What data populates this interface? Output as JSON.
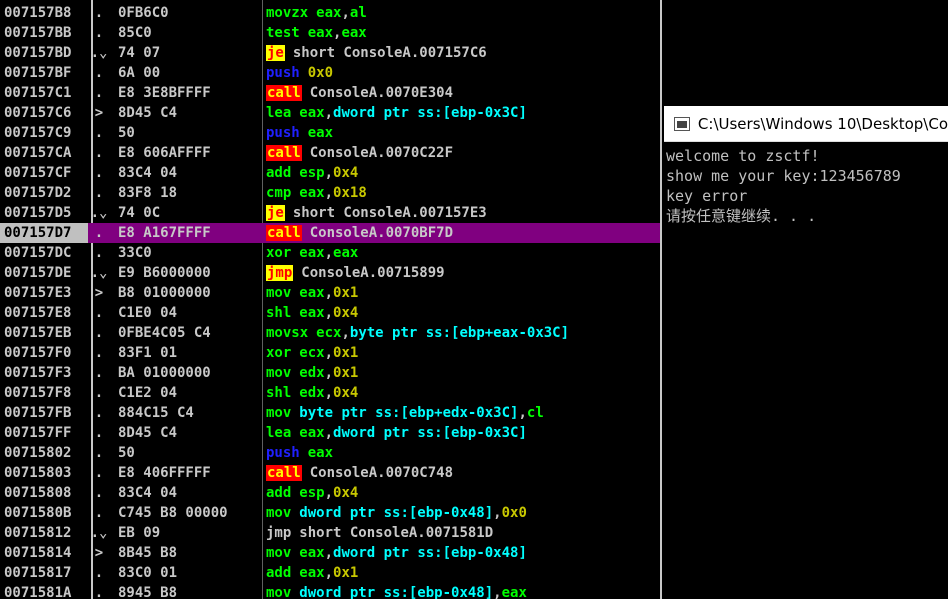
{
  "console": {
    "title": "C:\\Users\\Windows 10\\Desktop\\Co",
    "lines": [
      "welcome to zsctf!",
      "show me your key:123456789",
      "key error",
      "请按任意键继续. . ."
    ]
  },
  "disasm": {
    "rows": [
      {
        "addr": "007157B8",
        "marker": ".",
        "bytes": "0FB6C0",
        "mn": "movzx",
        "mn_style": "green",
        "ops": [
          [
            "eax",
            "reg"
          ],
          [
            ",",
            "default"
          ],
          [
            "al",
            "reg"
          ]
        ]
      },
      {
        "addr": "007157BB",
        "marker": ".",
        "bytes": "85C0",
        "mn": "test",
        "mn_style": "green",
        "ops": [
          [
            "eax",
            "reg"
          ],
          [
            ",",
            "default"
          ],
          [
            "eax",
            "reg"
          ]
        ]
      },
      {
        "addr": "007157BD",
        "marker": ".⌄",
        "bytes": "74 07",
        "mn": "je",
        "mn_style": "je",
        "ops": [
          [
            "short ConsoleA.007157C6",
            "default"
          ]
        ]
      },
      {
        "addr": "007157BF",
        "marker": ".",
        "bytes": "6A 00",
        "mn": "push",
        "mn_style": "blue",
        "ops": [
          [
            "0x0",
            "num"
          ]
        ]
      },
      {
        "addr": "007157C1",
        "marker": ".",
        "bytes": "E8 3E8BFFFF",
        "mn": "call",
        "mn_style": "call",
        "ops": [
          [
            "ConsoleA.0070E304",
            "default"
          ]
        ]
      },
      {
        "addr": "007157C6",
        "marker": ">",
        "bytes": "8D45 C4",
        "mn": "lea",
        "mn_style": "green",
        "ops": [
          [
            "eax",
            "reg"
          ],
          [
            ",",
            "default"
          ],
          [
            "dword ptr ss:[ebp-0x3C]",
            "cyan"
          ]
        ]
      },
      {
        "addr": "007157C9",
        "marker": ".",
        "bytes": "50",
        "mn": "push",
        "mn_style": "blue",
        "ops": [
          [
            "eax",
            "reg"
          ]
        ]
      },
      {
        "addr": "007157CA",
        "marker": ".",
        "bytes": "E8 606AFFFF",
        "mn": "call",
        "mn_style": "call",
        "ops": [
          [
            "ConsoleA.0070C22F",
            "default"
          ]
        ]
      },
      {
        "addr": "007157CF",
        "marker": ".",
        "bytes": "83C4 04",
        "mn": "add",
        "mn_style": "green",
        "ops": [
          [
            "esp",
            "reg"
          ],
          [
            ",",
            "default"
          ],
          [
            "0x4",
            "num"
          ]
        ]
      },
      {
        "addr": "007157D2",
        "marker": ".",
        "bytes": "83F8 18",
        "mn": "cmp",
        "mn_style": "green",
        "ops": [
          [
            "eax",
            "reg"
          ],
          [
            ",",
            "default"
          ],
          [
            "0x18",
            "num"
          ]
        ]
      },
      {
        "addr": "007157D5",
        "marker": ".⌄",
        "bytes": "74 0C",
        "mn": "je",
        "mn_style": "je",
        "ops": [
          [
            "short ConsoleA.007157E3",
            "default"
          ]
        ]
      },
      {
        "addr": "007157D7",
        "marker": ".",
        "bytes": "E8 A167FFFF",
        "mn": "call",
        "mn_style": "call",
        "ops": [
          [
            "ConsoleA.0070BF7D",
            "default"
          ]
        ],
        "selected": true
      },
      {
        "addr": "007157DC",
        "marker": ".",
        "bytes": "33C0",
        "mn": "xor",
        "mn_style": "green",
        "ops": [
          [
            "eax",
            "reg"
          ],
          [
            ",",
            "default"
          ],
          [
            "eax",
            "reg"
          ]
        ]
      },
      {
        "addr": "007157DE",
        "marker": ".⌄",
        "bytes": "E9 B6000000",
        "mn": "jmp",
        "mn_style": "je",
        "ops": [
          [
            "ConsoleA.00715899",
            "default"
          ]
        ]
      },
      {
        "addr": "007157E3",
        "marker": ">",
        "bytes": "B8 01000000",
        "mn": "mov",
        "mn_style": "green",
        "ops": [
          [
            "eax",
            "reg"
          ],
          [
            ",",
            "default"
          ],
          [
            "0x1",
            "num"
          ]
        ]
      },
      {
        "addr": "007157E8",
        "marker": ".",
        "bytes": "C1E0 04",
        "mn": "shl",
        "mn_style": "green",
        "ops": [
          [
            "eax",
            "reg"
          ],
          [
            ",",
            "default"
          ],
          [
            "0x4",
            "num"
          ]
        ]
      },
      {
        "addr": "007157EB",
        "marker": ".",
        "bytes": "0FBE4C05 C4",
        "mn": "movsx",
        "mn_style": "green",
        "ops": [
          [
            "ecx",
            "reg"
          ],
          [
            ",",
            "default"
          ],
          [
            "byte ptr ss:[ebp+eax-0x3C]",
            "cyan"
          ]
        ]
      },
      {
        "addr": "007157F0",
        "marker": ".",
        "bytes": "83F1 01",
        "mn": "xor",
        "mn_style": "green",
        "ops": [
          [
            "ecx",
            "reg"
          ],
          [
            ",",
            "default"
          ],
          [
            "0x1",
            "num"
          ]
        ]
      },
      {
        "addr": "007157F3",
        "marker": ".",
        "bytes": "BA 01000000",
        "mn": "mov",
        "mn_style": "green",
        "ops": [
          [
            "edx",
            "reg"
          ],
          [
            ",",
            "default"
          ],
          [
            "0x1",
            "num"
          ]
        ]
      },
      {
        "addr": "007157F8",
        "marker": ".",
        "bytes": "C1E2 04",
        "mn": "shl",
        "mn_style": "green",
        "ops": [
          [
            "edx",
            "reg"
          ],
          [
            ",",
            "default"
          ],
          [
            "0x4",
            "num"
          ]
        ]
      },
      {
        "addr": "007157FB",
        "marker": ".",
        "bytes": "884C15 C4",
        "mn": "mov",
        "mn_style": "green",
        "ops": [
          [
            "byte ptr ss:[ebp+edx-0x3C]",
            "cyan"
          ],
          [
            ",",
            "default"
          ],
          [
            "cl",
            "reg"
          ]
        ]
      },
      {
        "addr": "007157FF",
        "marker": ".",
        "bytes": "8D45 C4",
        "mn": "lea",
        "mn_style": "green",
        "ops": [
          [
            "eax",
            "reg"
          ],
          [
            ",",
            "default"
          ],
          [
            "dword ptr ss:[ebp-0x3C]",
            "cyan"
          ]
        ]
      },
      {
        "addr": "00715802",
        "marker": ".",
        "bytes": "50",
        "mn": "push",
        "mn_style": "blue",
        "ops": [
          [
            "eax",
            "reg"
          ]
        ]
      },
      {
        "addr": "00715803",
        "marker": ".",
        "bytes": "E8 406FFFFF",
        "mn": "call",
        "mn_style": "call",
        "ops": [
          [
            "ConsoleA.0070C748",
            "default"
          ]
        ]
      },
      {
        "addr": "00715808",
        "marker": ".",
        "bytes": "83C4 04",
        "mn": "add",
        "mn_style": "green",
        "ops": [
          [
            "esp",
            "reg"
          ],
          [
            ",",
            "default"
          ],
          [
            "0x4",
            "num"
          ]
        ]
      },
      {
        "addr": "0071580B",
        "marker": ".",
        "bytes": "C745 B8 00000",
        "mn": "mov",
        "mn_style": "green",
        "ops": [
          [
            "dword ptr ss:[ebp-0x48]",
            "cyan"
          ],
          [
            ",",
            "default"
          ],
          [
            "0x0",
            "num"
          ]
        ]
      },
      {
        "addr": "00715812",
        "marker": ".⌄",
        "bytes": "EB 09",
        "mn": "jmp",
        "mn_style": "default",
        "ops": [
          [
            "short ConsoleA.0071581D",
            "default"
          ]
        ]
      },
      {
        "addr": "00715814",
        "marker": ">",
        "bytes": "8B45 B8",
        "mn": "mov",
        "mn_style": "green",
        "ops": [
          [
            "eax",
            "reg"
          ],
          [
            ",",
            "default"
          ],
          [
            "dword ptr ss:[ebp-0x48]",
            "cyan"
          ]
        ]
      },
      {
        "addr": "00715817",
        "marker": ".",
        "bytes": "83C0 01",
        "mn": "add",
        "mn_style": "green",
        "ops": [
          [
            "eax",
            "reg"
          ],
          [
            ",",
            "default"
          ],
          [
            "0x1",
            "num"
          ]
        ]
      },
      {
        "addr": "0071581A",
        "marker": ".",
        "bytes": "8945 B8",
        "mn": "mov",
        "mn_style": "green",
        "ops": [
          [
            "dword ptr ss:[ebp-0x48]",
            "cyan"
          ],
          [
            ",",
            "default"
          ],
          [
            "eax",
            "reg"
          ]
        ]
      }
    ]
  }
}
